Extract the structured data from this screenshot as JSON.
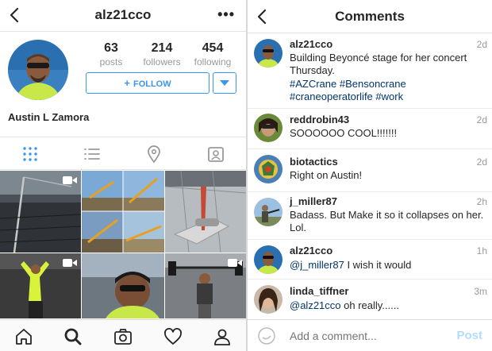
{
  "profile": {
    "username": "alz21cco",
    "full_name": "Austin L Zamora",
    "stats": [
      {
        "count": "63",
        "label": "posts"
      },
      {
        "count": "214",
        "label": "followers"
      },
      {
        "count": "454",
        "label": "following"
      }
    ],
    "follow_label": "FOLLOW",
    "more_glyph": "•••"
  },
  "comments_screen": {
    "title": "Comments",
    "comments": [
      {
        "user": "alz21cco",
        "time": "2d",
        "text": "Building Beyoncé stage for her concert Thursday.",
        "tags": "#AZCrane #Bensoncrane #craneoperatorlife #work"
      },
      {
        "user": "reddrobin43",
        "time": "2d",
        "text": "SOOOOOO COOL!!!!!!!"
      },
      {
        "user": "biotactics",
        "time": "2d",
        "text": "Right on Austin!"
      },
      {
        "user": "j_miller87",
        "time": "2h",
        "text": "Badass.  But Make it so it collapses on her. Lol."
      },
      {
        "user": "alz21cco",
        "time": "1h",
        "mention": "@j_miller87",
        "text": " I wish it would"
      },
      {
        "user": "linda_tiffner",
        "time": "3m",
        "mention": "@alz21cco",
        "text": " oh really......"
      }
    ],
    "input_placeholder": "Add a comment...",
    "post_label": "Post"
  },
  "colors": {
    "accent": "#3897f0",
    "link": "#003569",
    "muted": "#999999"
  }
}
